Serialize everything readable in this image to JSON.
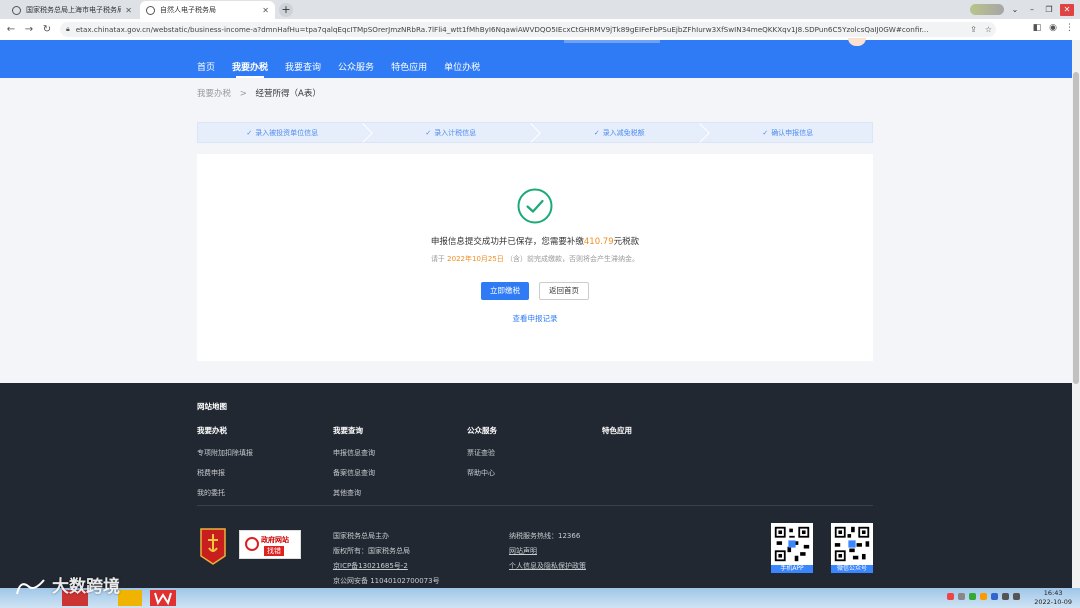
{
  "browser": {
    "tabs": [
      {
        "title": "国家税务总局上海市电子税务局",
        "active": false
      },
      {
        "title": "自然人电子税务局",
        "active": true
      }
    ],
    "url": "etax.chinatax.gov.cn/webstatic/business-income-a?dmnHafHu=tpa7qalqEqcITMpSOrerJmzNRbRa.7lFli4_wtt1fMhByI6NqawiAWVDQO5IEcxCtGHRMV9jTk89gEIFeFbPSuEjbZFhIurw3XfSwIN34meQKKXqv1J8.SDPun6C5YzolcsQaIJ0GW#confir..."
  },
  "nav": {
    "items": [
      "首页",
      "我要办税",
      "我要查询",
      "公众服务",
      "特色应用",
      "单位办税"
    ],
    "active_index": 1
  },
  "breadcrumb": {
    "parent": "我要办税",
    "separator": ">",
    "current": "经营所得（A表）"
  },
  "steps": [
    "录入被投资单位信息",
    "录入计税信息",
    "录入减免税额",
    "确认申报信息"
  ],
  "result": {
    "message_prefix": "申报信息提交成功并已保存，您需要补缴",
    "amount": "410.79",
    "message_suffix": "元税款",
    "deadline_prefix": "请于",
    "deadline_date": "2022年10月25日",
    "deadline_suffix": "（含）前完成缴款，否则将会产生滞纳金。",
    "pay_button": "立即缴税",
    "home_button": "返回首页",
    "record_link": "查看申报记录",
    "success_color": "#1aaa76",
    "accent_color": "#f08c1e"
  },
  "footer": {
    "site_map_title": "网站地图",
    "columns": [
      {
        "head": "我要办税",
        "links": [
          "专项附加扣除填报",
          "税费申报",
          "我的委托"
        ]
      },
      {
        "head": "我要查询",
        "links": [
          "申报信息查询",
          "备案信息查询",
          "其他查询"
        ]
      },
      {
        "head": "公众服务",
        "links": [
          "票证查验",
          "帮助中心"
        ]
      },
      {
        "head": "特色应用",
        "links": []
      }
    ],
    "gov_badge_line1": "政府网站",
    "gov_badge_line2": "找错",
    "host": "国家税务总局主办",
    "copyright": "版权所有：国家税务总局",
    "icp": "京ICP备13021685号-2",
    "police": "京公网安备 11040102700073号",
    "hotline": "纳税服务热线：12366",
    "statement": "网站声明",
    "privacy": "个人信息及隐私保护政策",
    "qr_app_label": "手机APP",
    "qr_wechat_label": "微信公众号"
  },
  "taskbar": {
    "time": "16:43",
    "date": "2022-10-09"
  },
  "watermark": "大数跨境"
}
